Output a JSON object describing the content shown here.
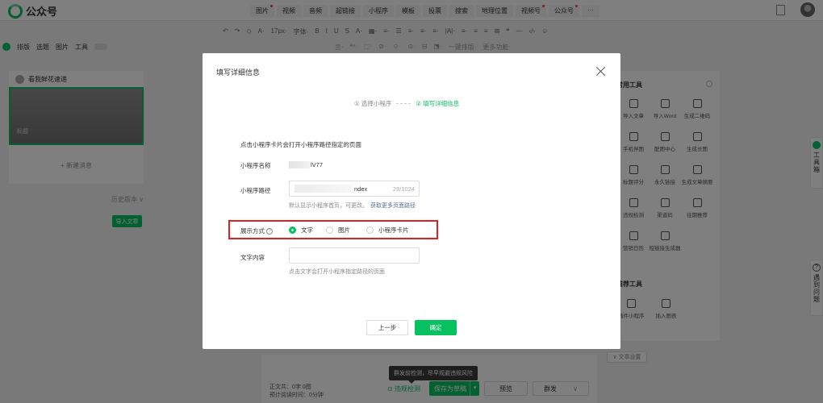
{
  "app": {
    "name": "公众号"
  },
  "top_menu": [
    {
      "label": "图片",
      "dot": true
    },
    {
      "label": "视频",
      "dot": false
    },
    {
      "label": "音频",
      "dot": false
    },
    {
      "label": "超链接",
      "dot": false
    },
    {
      "label": "小程序",
      "dot": false
    },
    {
      "label": "模板",
      "dot": false
    },
    {
      "label": "投票",
      "dot": false
    },
    {
      "label": "搜索",
      "dot": false
    },
    {
      "label": "地理位置",
      "dot": false
    },
    {
      "label": "视频号",
      "dot": true
    },
    {
      "label": "公众号",
      "dot": true
    },
    {
      "label": "···",
      "dot": false
    }
  ],
  "format_toolbar": {
    "row1": [
      "↶",
      "↷",
      "◇",
      "A·",
      "17px·",
      "字体·",
      "B",
      "I",
      "U",
      "S",
      "A·",
      "▦·",
      "≡·",
      "☰",
      "≡·",
      "≡·",
      "≡·",
      "|A|·",
      "≡·",
      "≡",
      "≡",
      "⊞",
      "❝",
      "—",
      "‹/›",
      "☺"
    ],
    "row2": [
      "亖·",
      "ᴬⁿ·",
      "⬚·",
      "⊘·",
      "☺·",
      "⊙·",
      "⊟",
      "⬔·",
      "一键排版·",
      "更多功能·"
    ]
  },
  "left_toolbar": {
    "items": [
      "排版",
      "选题",
      "图片",
      "工具"
    ]
  },
  "articles": {
    "account_name": "看我鲜花速递",
    "cover_label": "标题",
    "new_message": "+ 新建消息",
    "history": "历史版本 ∨",
    "import_button": "导入文章"
  },
  "tools_panel": {
    "title": "常用工具",
    "items": [
      "导入文章",
      "导入Word",
      "生成二维码",
      "手机伴图",
      "配图中心",
      "生成长图",
      "标题评分",
      "永久链接",
      "生成文章摘要",
      "违规检测",
      "渠道码",
      "往期推荐",
      "营销日历",
      "短链接生成器"
    ],
    "title2": "推荐工具",
    "items2": [
      "插件小程序",
      "插入图表"
    ],
    "cover_settings": "∨ 文章设置"
  },
  "side_float": {
    "toolbox": "工具箱",
    "help": "遇到问题"
  },
  "bottom_bar": {
    "word_count_1": "正文共：0字 0图",
    "word_count_2": "预计阅读时间：0分钟",
    "tooltip": "群发前检测，尽早规避违规风险",
    "check_link": "⊙ 违规检测",
    "save_button": "保存为草稿",
    "preview_button": "预览",
    "publish_button": "群发"
  },
  "modal": {
    "title": "填写详细信息",
    "step1": "① 选择小程序",
    "step2": "② 填写详细信息",
    "description": "点击小程序卡片会打开小程序路径指定的页面",
    "name_label": "小程序名称",
    "name_value": "lV77",
    "path_label": "小程序路径",
    "path_value": "ndex",
    "path_count": "23/1024",
    "path_hint": "默认显示小程序首页，可更改。",
    "path_hint_link": "获取更多页面路径",
    "display_label": "展示方式",
    "display_options": [
      "文字",
      "图片",
      "小程序卡片"
    ],
    "display_selected": "文字",
    "text_label": "文字内容",
    "text_value": "",
    "text_hint": "点击文字会打开小程序指定路径的页面",
    "prev_button": "上一步",
    "ok_button": "确定"
  },
  "colors": {
    "accent": "#07c160",
    "highlight_box": "#e02020",
    "link": "#576b95"
  }
}
